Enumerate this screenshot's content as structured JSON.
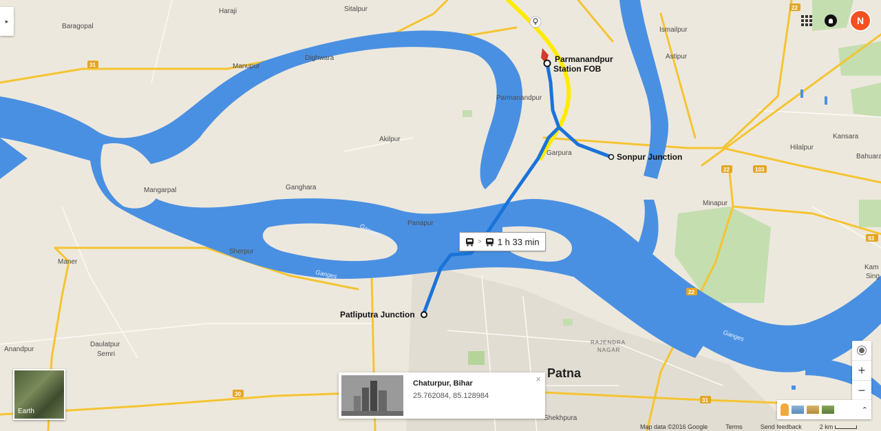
{
  "colors": {
    "land": "#ede8dd",
    "water": "#4a90e2",
    "road_major": "#f4c431",
    "route_blue": "#1a73d9",
    "route_yellow": "#ffeb00"
  },
  "map": {
    "places": [
      "Haraji",
      "Sitalpur",
      "Baragopal",
      "Dighwara",
      "Manupur",
      "Ismailpur",
      "Astipur",
      "Parmanandpur",
      "Akilpur",
      "Garpura",
      "Hilalpur",
      "Kansara",
      "Bahuara",
      "Mangarpal",
      "Ganghara",
      "Minapur",
      "Panapur",
      "Maner",
      "Sherpur",
      "Anandpur",
      "Daulatpur",
      "Semri",
      "Shekhpura",
      "Kam",
      "Sing"
    ],
    "river_label": "Ganges",
    "city": "Patna",
    "area_label": "RAJENDRA NAGAR",
    "route_shields": [
      "31",
      "22",
      "103",
      "93",
      "30"
    ]
  },
  "stops": {
    "origin_line1": "Parmanandpur",
    "origin_line2": "Station FOB",
    "sonpur": "Sonpur Junction",
    "patliputra": "Patliputra Junction"
  },
  "route_box": {
    "duration": "1 h 33 min",
    "chevron": ">"
  },
  "info_card": {
    "title": "Chaturpur, Bihar",
    "coords": "25.762084, 85.128984",
    "close": "×"
  },
  "earth": {
    "label": "Earth"
  },
  "zoom": {
    "plus": "+",
    "minus": "−"
  },
  "layers": {
    "expand": "⌃"
  },
  "footer": {
    "map_data": "Map data ©2016 Google",
    "terms": "Terms",
    "feedback": "Send feedback",
    "scale": "2 km"
  },
  "icons": [
    "menu-toggle-icon",
    "apps-grid-icon",
    "notifications-icon",
    "bus-icon",
    "pin-icon",
    "location-icon",
    "pegman-icon"
  ]
}
